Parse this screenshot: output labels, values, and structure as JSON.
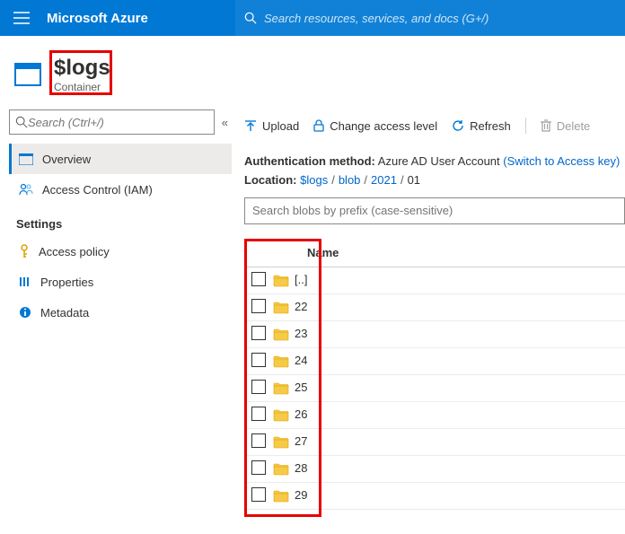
{
  "topbar": {
    "brand": "Microsoft Azure",
    "search_placeholder": "Search resources, services, and docs (G+/)"
  },
  "resource": {
    "title": "$logs",
    "type": "Container"
  },
  "sidebar": {
    "search_placeholder": "Search (Ctrl+/)",
    "items": [
      {
        "label": "Overview"
      },
      {
        "label": "Access Control (IAM)"
      }
    ],
    "settings_heading": "Settings",
    "settings_items": [
      {
        "label": "Access policy"
      },
      {
        "label": "Properties"
      },
      {
        "label": "Metadata"
      }
    ]
  },
  "commands": {
    "upload": "Upload",
    "change_access": "Change access level",
    "refresh": "Refresh",
    "delete": "Delete"
  },
  "details": {
    "auth_label": "Authentication method:",
    "auth_value": "Azure AD User Account",
    "switch_link": "(Switch to Access key)",
    "location_label": "Location:",
    "breadcrumb": [
      "$logs",
      "blob",
      "2021",
      "01"
    ]
  },
  "blob_search_placeholder": "Search blobs by prefix (case-sensitive)",
  "table": {
    "name_header": "Name",
    "rows": [
      {
        "name": "[..]"
      },
      {
        "name": "22"
      },
      {
        "name": "23"
      },
      {
        "name": "24"
      },
      {
        "name": "25"
      },
      {
        "name": "26"
      },
      {
        "name": "27"
      },
      {
        "name": "28"
      },
      {
        "name": "29"
      }
    ]
  }
}
